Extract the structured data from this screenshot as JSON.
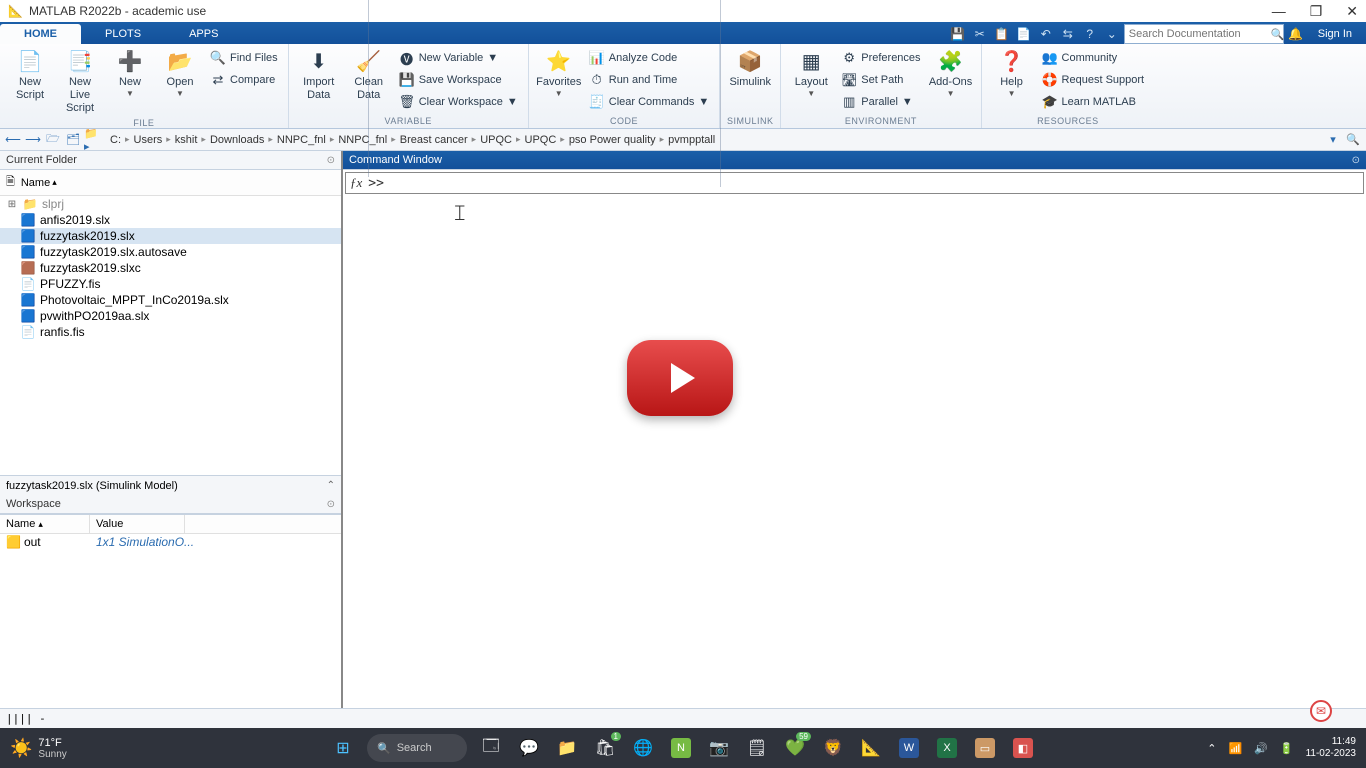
{
  "window": {
    "title": "MATLAB R2022b - academic use"
  },
  "tabs": [
    "HOME",
    "PLOTS",
    "APPS"
  ],
  "search_placeholder": "Search Documentation",
  "signin_label": "Sign In",
  "toolstrip": {
    "file": {
      "label": "FILE",
      "new_script": "New\nScript",
      "new_livescript": "New\nLive Script",
      "new": "New",
      "open": "Open",
      "find_files": "Find Files",
      "compare": "Compare"
    },
    "variable": {
      "label": "VARIABLE",
      "import": "Import\nData",
      "clean": "Clean\nData",
      "new_var": "New Variable",
      "save_ws": "Save Workspace",
      "clear_ws": "Clear Workspace"
    },
    "code": {
      "label": "CODE",
      "favorites": "Favorites",
      "analyze": "Analyze Code",
      "run_time": "Run and Time",
      "clear_cmd": "Clear Commands"
    },
    "simulink": {
      "label": "SIMULINK",
      "btn": "Simulink"
    },
    "env": {
      "label": "ENVIRONMENT",
      "layout": "Layout",
      "prefs": "Preferences",
      "setpath": "Set Path",
      "parallel": "Parallel",
      "addons": "Add-Ons"
    },
    "resources": {
      "label": "RESOURCES",
      "help": "Help",
      "community": "Community",
      "support": "Request Support",
      "learn": "Learn MATLAB"
    }
  },
  "breadcrumb": [
    "C:",
    "Users",
    "kshit",
    "Downloads",
    "NNPC_fnl",
    "NNPC_fnl",
    "Breast cancer",
    "UPQC",
    "UPQC",
    "pso Power quality",
    "pvmpptall"
  ],
  "panels": {
    "current_folder": "Current Folder",
    "command_window": "Command Window",
    "workspace": "Workspace",
    "name_header": "Name",
    "value_header": "Value"
  },
  "files": [
    {
      "name": "slprj",
      "type": "folder",
      "dim": true
    },
    {
      "name": "anfis2019.slx",
      "type": "slx"
    },
    {
      "name": "fuzzytask2019.slx",
      "type": "slx",
      "selected": true
    },
    {
      "name": "fuzzytask2019.slx.autosave",
      "type": "slx"
    },
    {
      "name": "fuzzytask2019.slxc",
      "type": "slxc"
    },
    {
      "name": "PFUZZY.fis",
      "type": "file"
    },
    {
      "name": "Photovoltaic_MPPT_InCo2019a.slx",
      "type": "slx"
    },
    {
      "name": "pvwithPO2019aa.slx",
      "type": "slx"
    },
    {
      "name": "ranfis.fis",
      "type": "file"
    }
  ],
  "details": "fuzzytask2019.slx  (Simulink Model)",
  "workspace_vars": [
    {
      "name": "out",
      "value": "1x1 SimulationO..."
    }
  ],
  "prompt": ">>",
  "status": "|||| -",
  "taskbar": {
    "temp": "71°F",
    "cond": "Sunny",
    "search": "Search",
    "time": "11:49",
    "date": "11-02-2023",
    "badge1": "1",
    "badge2": "59"
  }
}
